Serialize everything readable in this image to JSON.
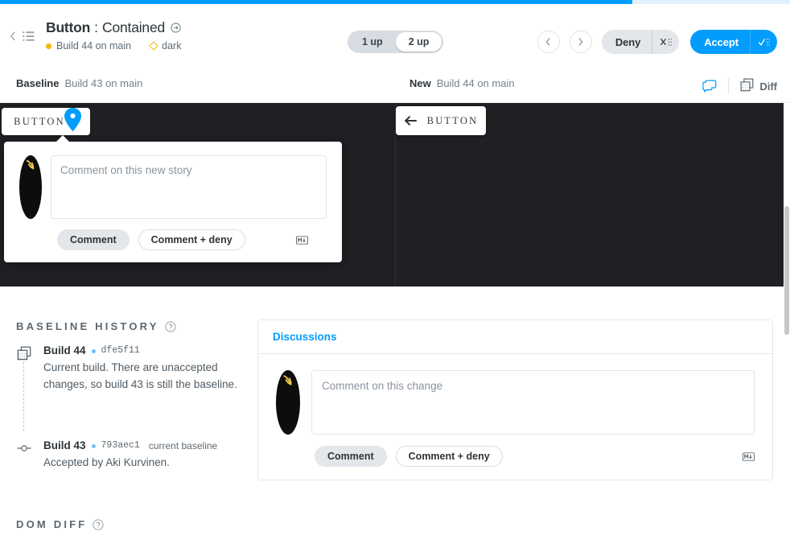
{
  "progress": {
    "percent": 80
  },
  "header": {
    "back_icon": "chevron-left-icon",
    "list_icon": "list-icon",
    "component": "Button",
    "separator": ":",
    "story": "Contained",
    "link_icon": "circle-arrow-icon",
    "build_status": "Build 44 on main",
    "theme": "dark",
    "view_toggle": {
      "options": [
        "1 up",
        "2 up"
      ],
      "selected": "2 up"
    },
    "prev_icon": "chevron-left-icon",
    "next_icon": "chevron-right-icon",
    "deny_label": "Deny",
    "deny_icon": "deny-shortcut-icon",
    "accept_label": "Accept",
    "accept_icon": "accept-shortcut-icon"
  },
  "compare": {
    "baseline_label": "Baseline",
    "baseline_value": "Build 43 on main",
    "new_label": "New",
    "new_value": "Build 44 on main",
    "comment_icon": "comment-icon",
    "diff_label": "Diff",
    "diff_icon": "diff-squares-icon"
  },
  "canvas": {
    "baseline_button_label": "BUTTON",
    "new_button_label": "BUTTON",
    "new_button_icon": "arrow-left-icon",
    "pin_icon": "map-pin-icon"
  },
  "popover": {
    "avatar": "user-avatar",
    "placeholder": "Comment on this new story",
    "value": "",
    "comment_label": "Comment",
    "comment_deny_label": "Comment + deny",
    "markdown_icon": "markdown-icon"
  },
  "baseline_history": {
    "title": "Baseline History",
    "help_icon": "help-circle-icon",
    "builds": [
      {
        "name": "Build 44",
        "hash": "dfe5f11",
        "tag": "",
        "description": "Current build. There are unaccepted changes, so build 43 is still the baseline.",
        "icon": "snapshot-squares-icon"
      },
      {
        "name": "Build 43",
        "hash": "793aec1",
        "tag": "current baseline",
        "description": "Accepted by Aki Kurvinen.",
        "icon": "commit-node-icon"
      }
    ]
  },
  "discussions": {
    "title": "Discussions",
    "avatar": "user-avatar",
    "placeholder": "Comment on this change",
    "value": "",
    "comment_label": "Comment",
    "comment_deny_label": "Comment + deny",
    "markdown_icon": "markdown-icon"
  },
  "dom_diff": {
    "title": "DOM Diff",
    "help_icon": "help-circle-icon"
  },
  "colors": {
    "accent": "#029cfd",
    "amber": "#f5b700",
    "canvas_dark": "#1e2023",
    "muted": "#5f6b74"
  }
}
